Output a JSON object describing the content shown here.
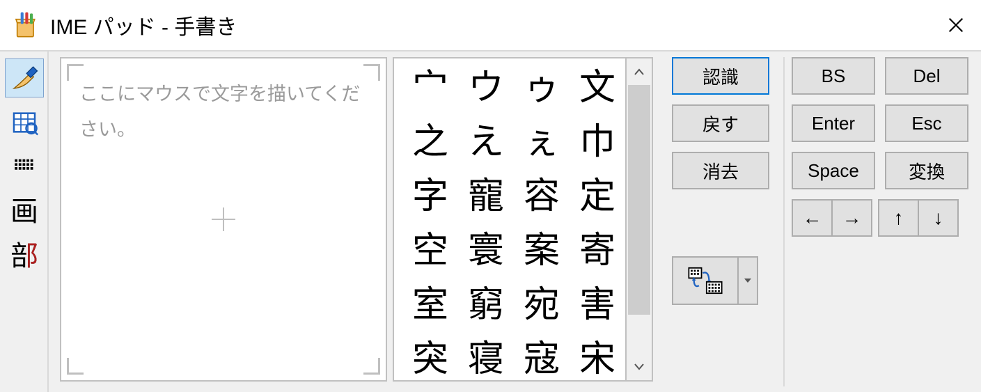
{
  "titlebar": {
    "title": "IME パッド - 手書き"
  },
  "sidebar": {
    "items": [
      {
        "id": "handwriting",
        "icon": "pen-icon",
        "text": ""
      },
      {
        "id": "charlist",
        "icon": "charlist-icon",
        "text": ""
      },
      {
        "id": "softkbd",
        "icon": "keyboard-icon",
        "text": ""
      },
      {
        "id": "strokes",
        "icon": "",
        "text": "画"
      },
      {
        "id": "radicals",
        "icon": "",
        "text": "部"
      }
    ]
  },
  "draw": {
    "placeholder": "ここにマウスで文字を描いてください。"
  },
  "candidates": [
    [
      "宀",
      "ウ",
      "ゥ",
      "文"
    ],
    [
      "之",
      "え",
      "ぇ",
      "巾"
    ],
    [
      "字",
      "寵",
      "容",
      "定"
    ],
    [
      "空",
      "寰",
      "案",
      "寄"
    ],
    [
      "室",
      "窮",
      "宛",
      "害"
    ],
    [
      "突",
      "寝",
      "寇",
      "宋"
    ]
  ],
  "actions": {
    "recognize": "認識",
    "undo": "戻す",
    "clear": "消去"
  },
  "keys": {
    "bs": "BS",
    "del": "Del",
    "enter": "Enter",
    "esc": "Esc",
    "space": "Space",
    "convert": "変換",
    "left": "←",
    "right": "→",
    "up": "↑",
    "down": "↓"
  }
}
